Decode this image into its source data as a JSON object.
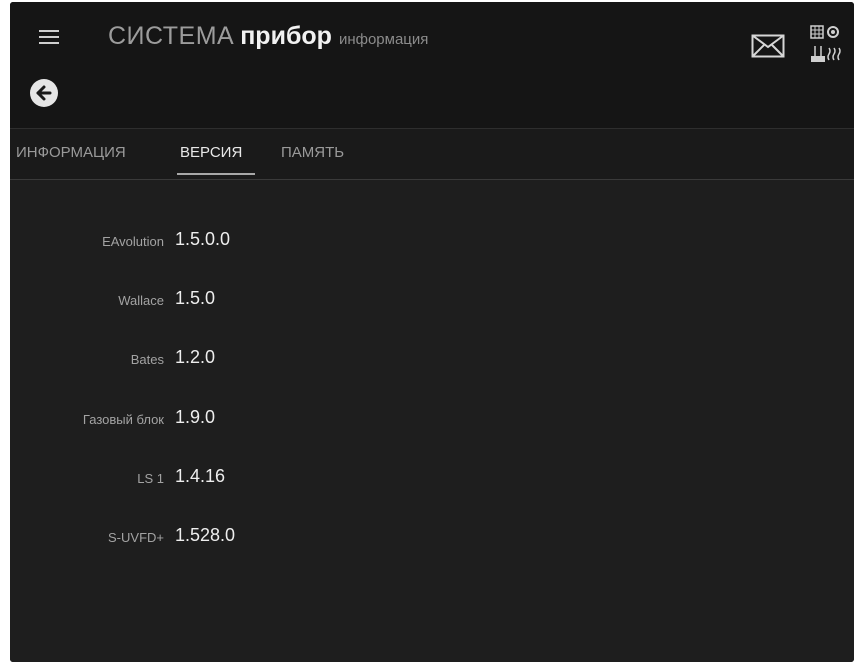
{
  "header": {
    "title_system": "СИСТЕМА",
    "title_device": "прибор",
    "title_sub": "информация",
    "menu_icon": "hamburger-menu-icon",
    "mail_icon": "mail-envelope-icon",
    "status_icon": "device-status-icon"
  },
  "nav": {
    "back_icon": "arrow-left-circle-icon"
  },
  "tabs": [
    {
      "label": "ИНФОРМАЦИЯ",
      "active": false
    },
    {
      "label": "ВЕРСИЯ",
      "active": true
    },
    {
      "label": "ПАМЯТЬ",
      "active": false
    }
  ],
  "versions": [
    {
      "label": "EAvolution",
      "value": "1.5.0.0"
    },
    {
      "label": "Wallace",
      "value": "1.5.0"
    },
    {
      "label": "Bates",
      "value": "1.2.0"
    },
    {
      "label": "Газовый блок",
      "value": "1.9.0"
    },
    {
      "label": "LS 1",
      "value": "1.4.16"
    },
    {
      "label": "S-UVFD+",
      "value": "1.528.0"
    }
  ],
  "colors": {
    "background": "#1d1d1d",
    "header_background": "#151515",
    "text_primary": "#eeeeee",
    "text_secondary": "#a3a3a3",
    "tab_indicator": "#a8a8a8"
  }
}
